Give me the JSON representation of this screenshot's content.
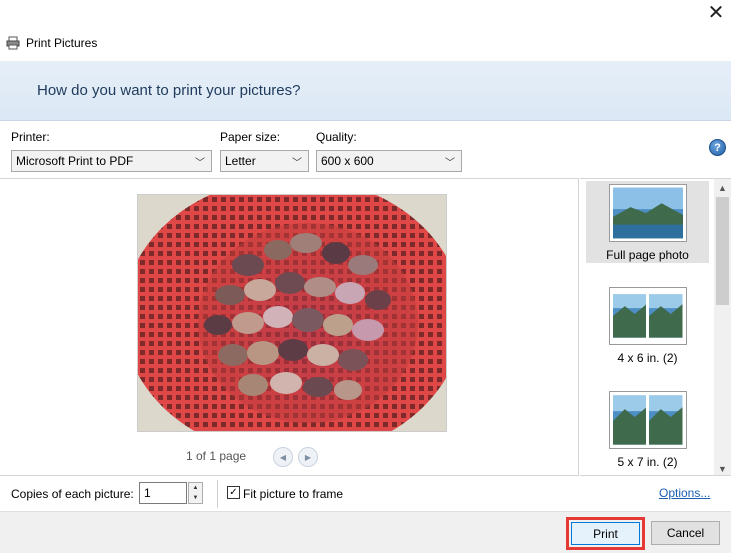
{
  "window": {
    "title": "Print Pictures",
    "close_glyph": "✕"
  },
  "banner": {
    "heading": "How do you want to print your pictures?"
  },
  "printer": {
    "label": "Printer:",
    "value": "Microsoft Print to PDF"
  },
  "paper_size": {
    "label": "Paper size:",
    "value": "Letter"
  },
  "quality": {
    "label": "Quality:",
    "value": "600 x 600"
  },
  "help": {
    "glyph": "?"
  },
  "preview": {
    "page_count": "1 of 1 page"
  },
  "layouts": {
    "items": [
      {
        "label": "Full page photo",
        "selected": true
      },
      {
        "label": "4 x 6 in. (2)",
        "selected": false
      },
      {
        "label": "5 x 7 in. (2)",
        "selected": false
      }
    ]
  },
  "copies": {
    "label": "Copies of each picture:",
    "value": "1"
  },
  "fit": {
    "label": "Fit picture to frame",
    "checked": true
  },
  "options": {
    "label": "Options..."
  },
  "buttons": {
    "print": "Print",
    "cancel": "Cancel"
  },
  "colors": {
    "banner_text": "#1e3a5c",
    "link": "#1a5fb4",
    "highlight": "#e53935",
    "primary_border": "#0078d7"
  }
}
